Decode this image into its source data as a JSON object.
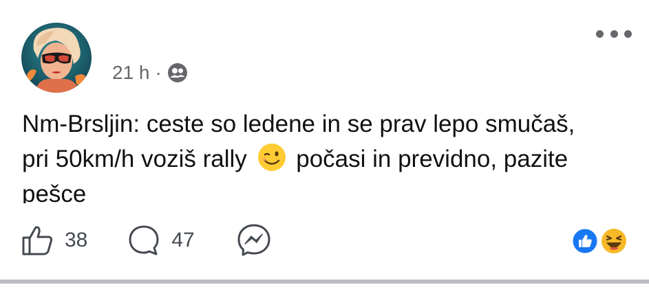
{
  "post": {
    "author": {
      "name": ""
    },
    "time": "21 h",
    "separator": "·",
    "audience_icon": "friends-icon",
    "menu_icon": "more-horizontal-icon",
    "text": {
      "before_emoji": "Nm-Brsljin: ceste so ledene in se prav lepo smučaš, pri 50km/h voziš rally",
      "emoji": "winking-face",
      "after_emoji": "počasi in previdno, pazite pešce"
    }
  },
  "actions": {
    "like": {
      "icon": "thumbs-up-outline-icon",
      "count": "38"
    },
    "comment": {
      "icon": "comment-bubble-icon",
      "count": "47"
    },
    "share": {
      "icon": "messenger-icon"
    }
  },
  "reactions": [
    "like",
    "haha"
  ],
  "colors": {
    "text": "#111111",
    "meta": "#65676b",
    "like_blue": "#1877f2",
    "haha_yellow": "#f7b928",
    "divider": "#b9bcc1"
  }
}
